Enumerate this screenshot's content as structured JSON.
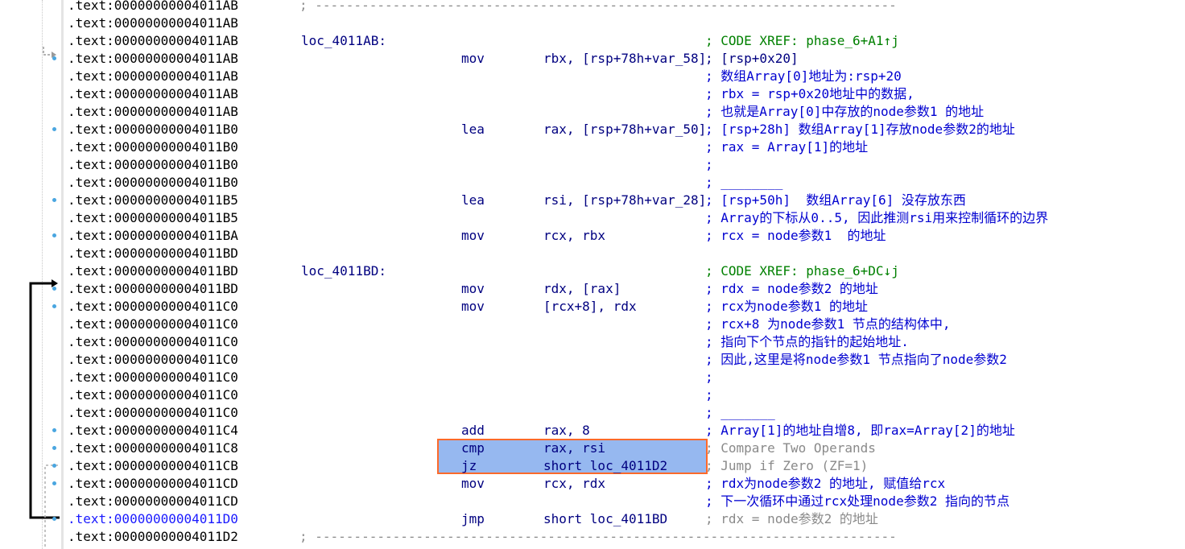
{
  "rows": [
    {
      "addr": ".text:00000000004011AB",
      "sep": "; ---------------------------------------------------------------------------"
    },
    {
      "addr": ".text:00000000004011AB"
    },
    {
      "addr": ".text:00000000004011AB",
      "label": "loc_4011AB:",
      "cmt": "; CODE XREF: phase_6+A1↑j",
      "cmt_style": "green"
    },
    {
      "addr": ".text:00000000004011AB",
      "mn": "mov",
      "op": "rbx, [rsp+78h+var_58]",
      "cmt": "; [rsp+0x20]",
      "cmt_style": "plain"
    },
    {
      "addr": ".text:00000000004011AB",
      "cmt": "; 数组Array[0]地址为:rsp+20",
      "cmt_style": "cn"
    },
    {
      "addr": ".text:00000000004011AB",
      "cmt": "; rbx = rsp+0x20地址中的数据,",
      "cmt_style": "cn"
    },
    {
      "addr": ".text:00000000004011AB",
      "cmt": "; 也就是Array[0]中存放的node参数1 的地址",
      "cmt_style": "cn"
    },
    {
      "addr": ".text:00000000004011B0",
      "mn": "lea",
      "op": "rax, [rsp+78h+var_50]",
      "cmt": "; [rsp+28h] 数组Array[1]存放node参数2的地址",
      "cmt_style": "cn"
    },
    {
      "addr": ".text:00000000004011B0",
      "cmt": "; rax = Array[1]的地址",
      "cmt_style": "cn"
    },
    {
      "addr": ".text:00000000004011B0",
      "cmt": ";",
      "cmt_style": "cn"
    },
    {
      "addr": ".text:00000000004011B0",
      "cmt": "; ________",
      "cmt_style": "cn"
    },
    {
      "addr": ".text:00000000004011B5",
      "mn": "lea",
      "op": "rsi, [rsp+78h+var_28]",
      "cmt": "; [rsp+50h]  数组Array[6] 没存放东西",
      "cmt_style": "cn"
    },
    {
      "addr": ".text:00000000004011B5",
      "cmt": "; Array的下标从0..5, 因此推测rsi用来控制循环的边界",
      "cmt_style": "cn"
    },
    {
      "addr": ".text:00000000004011BA",
      "mn": "mov",
      "op": "rcx, rbx",
      "cmt": "; rcx = node参数1  的地址",
      "cmt_style": "cn"
    },
    {
      "addr": ".text:00000000004011BD"
    },
    {
      "addr": ".text:00000000004011BD",
      "label": "loc_4011BD:",
      "cmt": "; CODE XREF: phase_6+DC↓j",
      "cmt_style": "green"
    },
    {
      "addr": ".text:00000000004011BD",
      "mn": "mov",
      "op": "rdx, [rax]",
      "cmt": "; rdx = node参数2 的地址",
      "cmt_style": "cn"
    },
    {
      "addr": ".text:00000000004011C0",
      "mn": "mov",
      "op": "[rcx+8], rdx",
      "cmt": "; rcx为node参数1 的地址",
      "cmt_style": "cn"
    },
    {
      "addr": ".text:00000000004011C0",
      "cmt": "; rcx+8 为node参数1 节点的结构体中,",
      "cmt_style": "cn"
    },
    {
      "addr": ".text:00000000004011C0",
      "cmt": "; 指向下个节点的指针的起始地址.",
      "cmt_style": "cn"
    },
    {
      "addr": ".text:00000000004011C0",
      "cmt": "; 因此,这里是将node参数1 节点指向了node参数2",
      "cmt_style": "cn"
    },
    {
      "addr": ".text:00000000004011C0",
      "cmt": ";",
      "cmt_style": "cn"
    },
    {
      "addr": ".text:00000000004011C0",
      "cmt": ";",
      "cmt_style": "cn"
    },
    {
      "addr": ".text:00000000004011C0",
      "cmt": "; _______",
      "cmt_style": "cn"
    },
    {
      "addr": ".text:00000000004011C4",
      "mn": "add",
      "op": "rax, 8",
      "cmt": "; Array[1]的地址自增8, 即rax=Array[2]的地址",
      "cmt_style": "cn"
    },
    {
      "addr": ".text:00000000004011C8",
      "mn": "cmp",
      "op": "rax, rsi",
      "cmt": "; Compare Two Operands",
      "cmt_style": "gray"
    },
    {
      "addr": ".text:00000000004011CB",
      "mn": "jz",
      "op": "short loc_4011D2",
      "cmt": "; Jump if Zero (ZF=1)",
      "cmt_style": "gray"
    },
    {
      "addr": ".text:00000000004011CD",
      "mn": "mov",
      "op": "rcx, rdx",
      "cmt": "; rdx为node参数2 的地址, 赋值给rcx",
      "cmt_style": "cn"
    },
    {
      "addr": ".text:00000000004011CD",
      "cmt": "; 下一次循环中通过rcx处理node参数2 指向的节点",
      "cmt_style": "cn"
    },
    {
      "addr": ".text:00000000004011D0",
      "mn": "jmp",
      "op": "short loc_4011BD",
      "cmt": "; rdx = node参数2 的地址",
      "cmt_style": "gray",
      "addr_style": "blue"
    },
    {
      "addr": ".text:00000000004011D2",
      "sep": "; ---------------------------------------------------------------------------"
    }
  ],
  "colors": {
    "highlight_fill": "#96b8f0",
    "highlight_border": "#ff6a2a",
    "xref_green": "#008000",
    "comment_blue": "#0000d0",
    "gray": "#8a8a8a"
  }
}
